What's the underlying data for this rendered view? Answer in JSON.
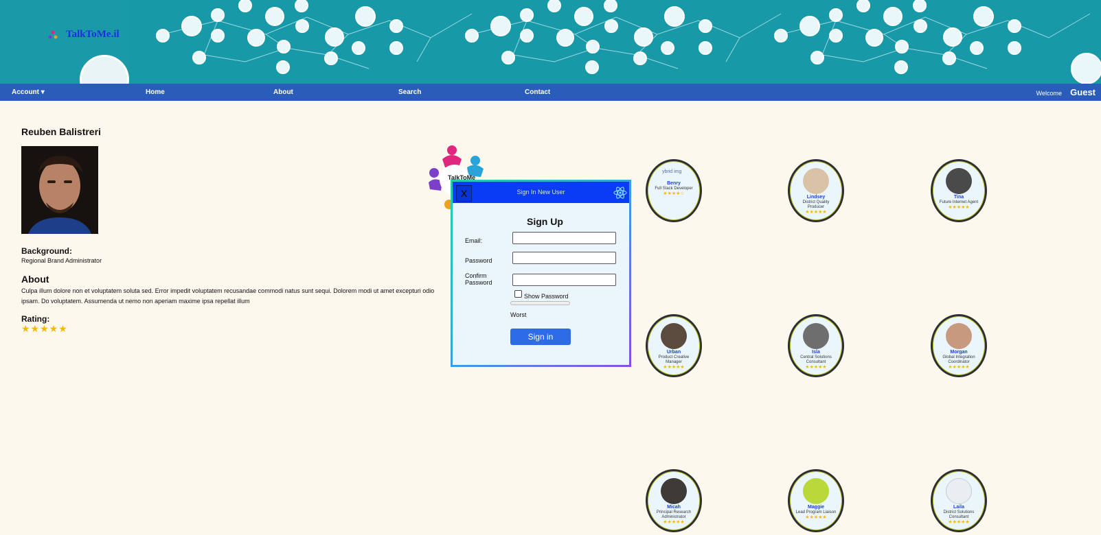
{
  "brand": {
    "name": "TalkToMe.il"
  },
  "nav": {
    "account": "Account ▾",
    "home": "Home",
    "about": "About",
    "search": "Search",
    "contact": "Contact",
    "welcome": "Welcome",
    "user": "Guest"
  },
  "profile": {
    "name": "Reuben Balistreri",
    "background_heading": "Background:",
    "background": "Regional Brand Administrator",
    "about_heading": "About",
    "about": "Culpa illum dolore non et voluptatem soluta sed. Error impedit voluptatem recusandae commodi natus sunt sequi. Dolorem modi ut amet excepturi odio ipsam. Do voluptatem. Assumenda ut nemo non aperiam maxime ipsa repellat illum",
    "rating_heading": "Rating:",
    "rating": 5,
    "stars": "★★★★★"
  },
  "center_logo": {
    "text": "TalkToMe"
  },
  "modal": {
    "close": "X",
    "title": "Sign In New User",
    "heading": "Sign Up",
    "email_label": "Email:",
    "email_value": "",
    "password_label": "Password",
    "password_value": "",
    "confirm_label": "Confirm Password",
    "confirm_value": "",
    "show_password": "Show Password",
    "strength": "Worst",
    "submit": "Sign in"
  },
  "users": [
    {
      "name": "Benry",
      "title": "Full Stack Developer",
      "stars": "★★★★☆",
      "photo_alt": "ybrid img"
    },
    {
      "name": "Lindsey",
      "title": "District Quality Producer",
      "stars": "★★★★★"
    },
    {
      "name": "Tina",
      "title": "Future Internet Agent",
      "stars": "★★★★★"
    },
    {
      "name": "Urban",
      "title": "Product Creative Manager",
      "stars": "★★★★★"
    },
    {
      "name": "Isla",
      "title": "Central Solutions Consultant",
      "stars": "★★★★★"
    },
    {
      "name": "Morgan",
      "title": "Global Integration Coordinator",
      "stars": "★★★★★"
    },
    {
      "name": "Micah",
      "title": "Principal Research Administrator",
      "stars": "★★★★★"
    },
    {
      "name": "Maggie",
      "title": "Lead Program Liaison",
      "stars": "★★★★★"
    },
    {
      "name": "Laila",
      "title": "District Solutions Consultant",
      "stars": "★★★★★"
    }
  ],
  "colors": {
    "banner": "#1899a8",
    "navbar": "#2a5dba",
    "page_bg": "#fdf8ee",
    "modal_header": "#0a3cf5",
    "primary_button": "#2d6ce6",
    "star": "#f5b800"
  }
}
